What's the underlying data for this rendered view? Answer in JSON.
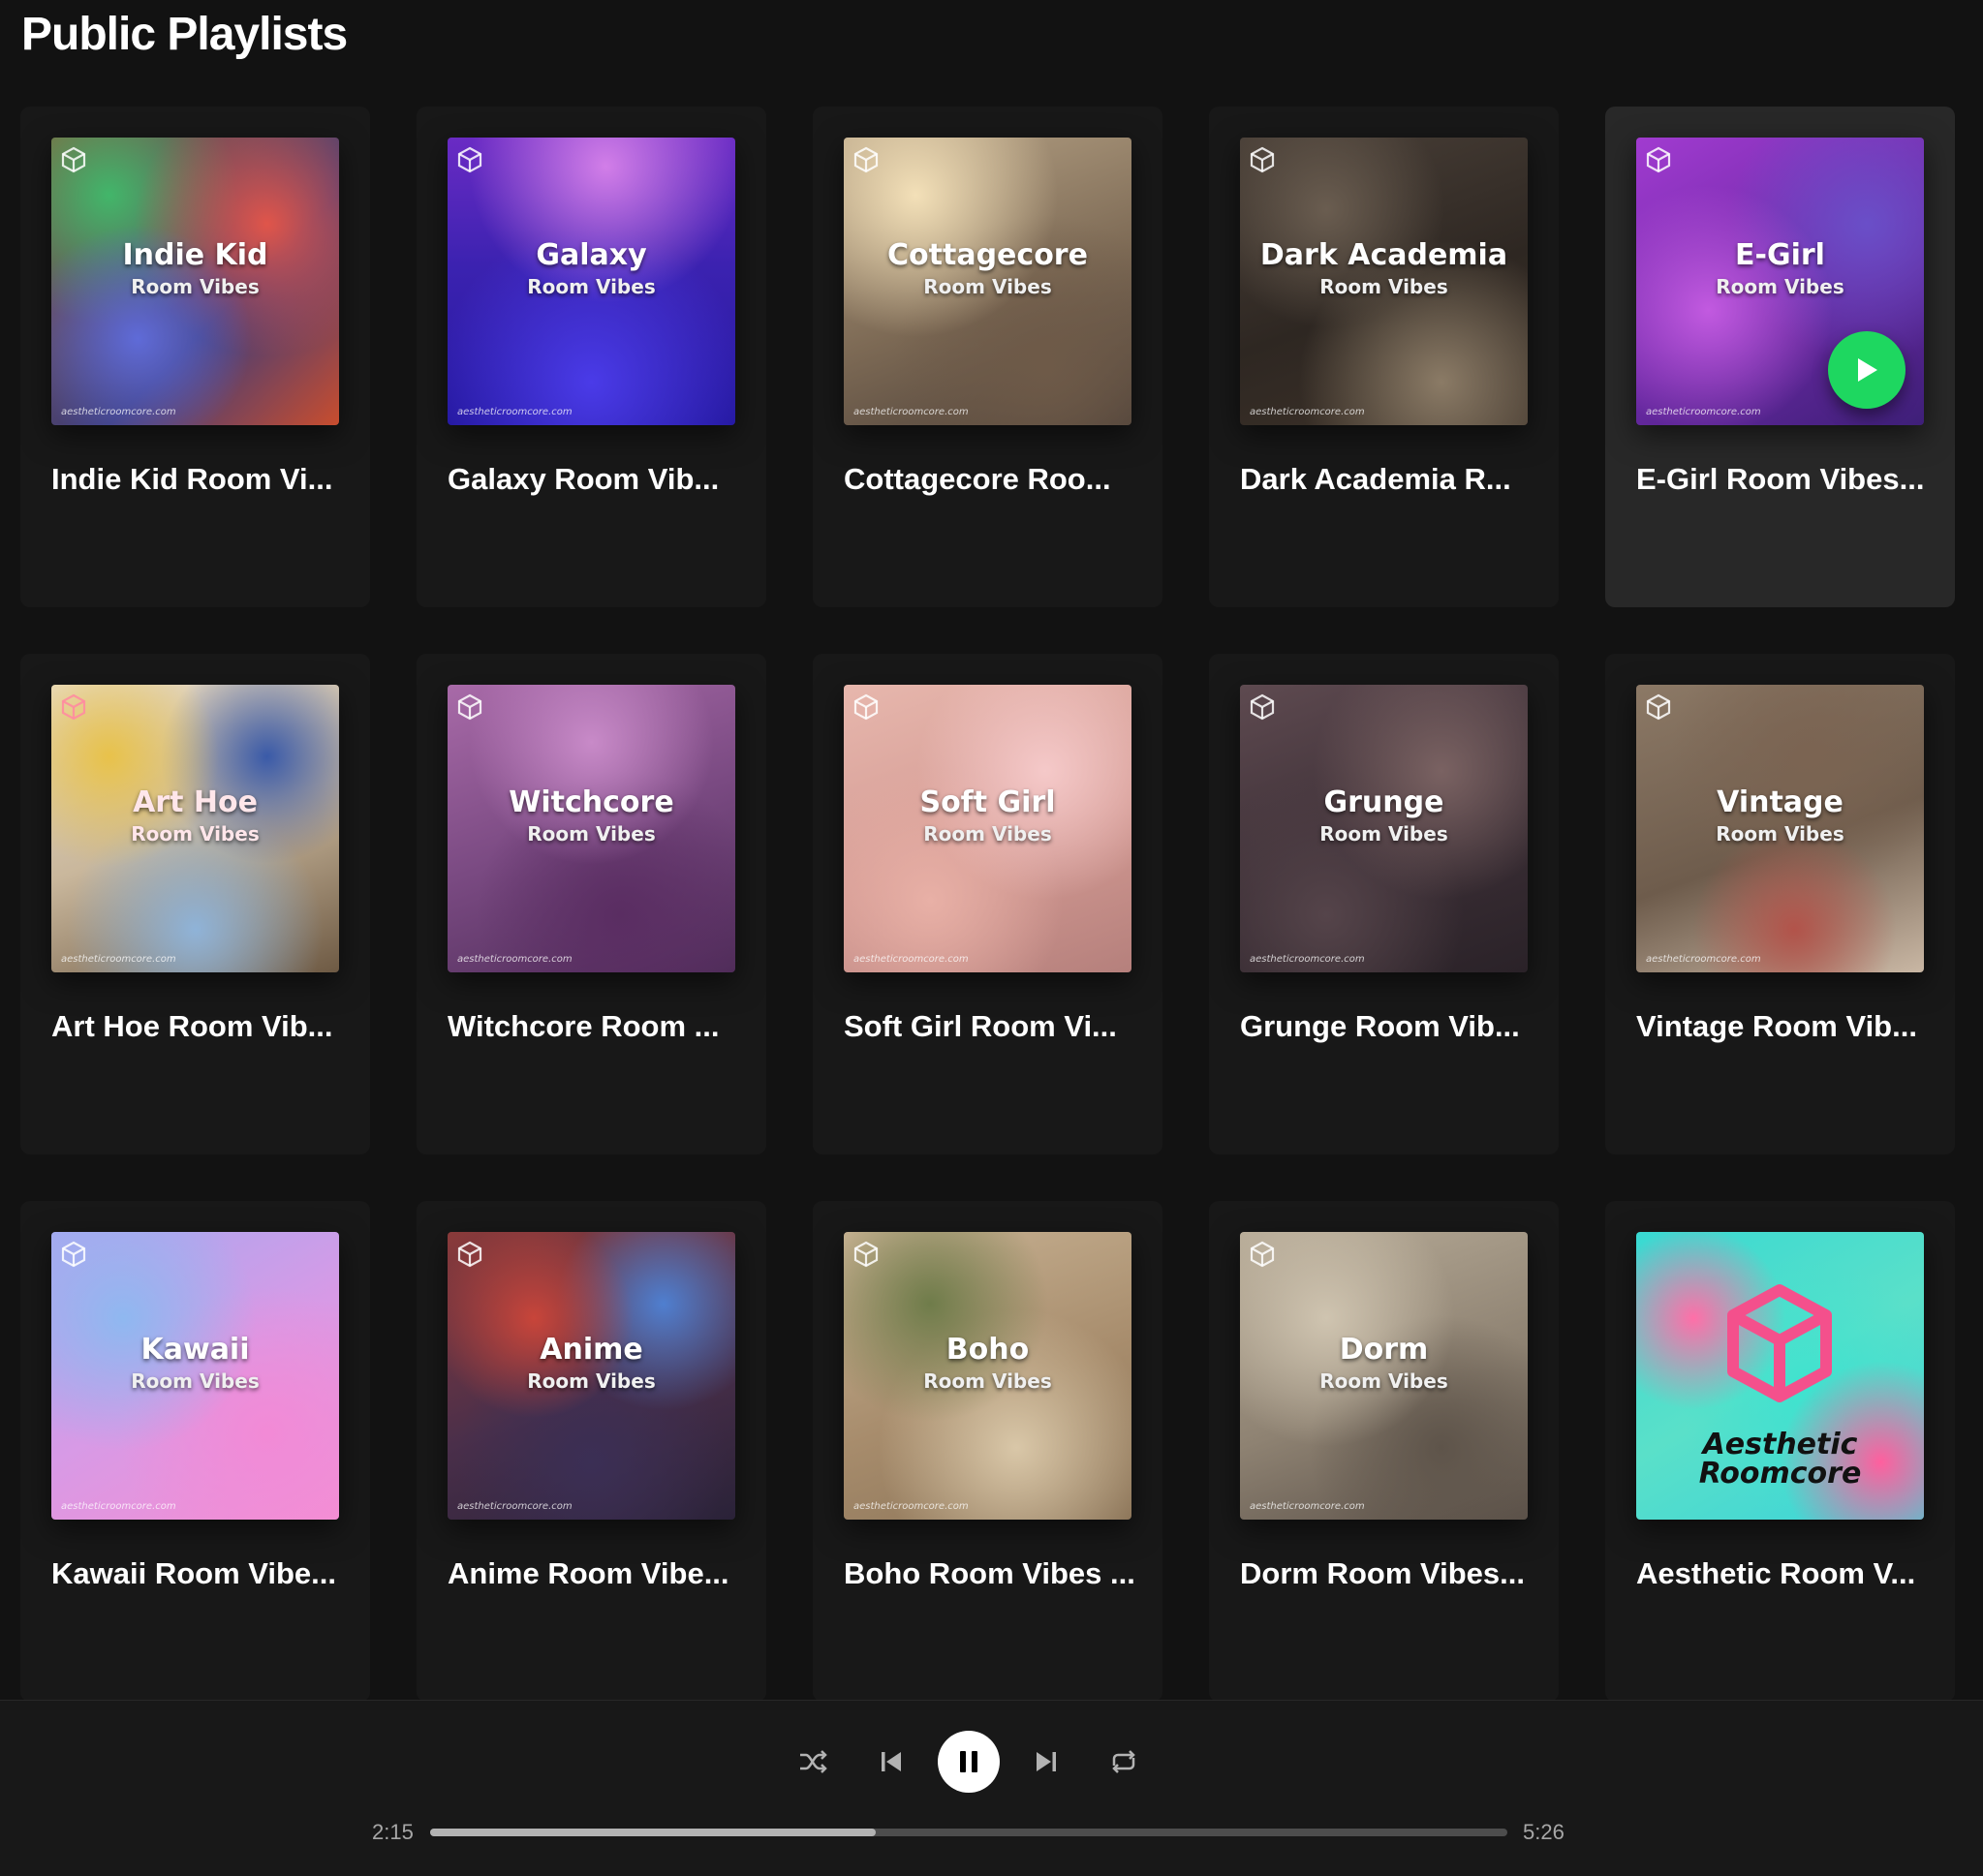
{
  "section": {
    "title": "Public Playlists"
  },
  "playlists": [
    {
      "name": "Indie Kid Room Vi...",
      "cover_title": "Indie Kid",
      "cover_subtitle": "Room Vibes",
      "watermark": "aestheticroomcore.com"
    },
    {
      "name": "Galaxy Room Vib...",
      "cover_title": "Galaxy",
      "cover_subtitle": "Room Vibes",
      "watermark": "aestheticroomcore.com"
    },
    {
      "name": "Cottagecore Roo...",
      "cover_title": "Cottagecore",
      "cover_subtitle": "Room Vibes",
      "watermark": "aestheticroomcore.com"
    },
    {
      "name": "Dark Academia R...",
      "cover_title": "Dark Academia",
      "cover_subtitle": "Room Vibes",
      "watermark": "aestheticroomcore.com"
    },
    {
      "name": "E-Girl Room Vibes...",
      "cover_title": "E-Girl",
      "cover_subtitle": "Room Vibes",
      "watermark": "aestheticroomcore.com"
    },
    {
      "name": "Art Hoe Room Vib...",
      "cover_title": "Art Hoe",
      "cover_subtitle": "Room Vibes",
      "watermark": "aestheticroomcore.com"
    },
    {
      "name": "Witchcore Room ...",
      "cover_title": "Witchcore",
      "cover_subtitle": "Room Vibes",
      "watermark": "aestheticroomcore.com"
    },
    {
      "name": "Soft Girl Room Vi...",
      "cover_title": "Soft Girl",
      "cover_subtitle": "Room Vibes",
      "watermark": "aestheticroomcore.com"
    },
    {
      "name": "Grunge Room Vib...",
      "cover_title": "Grunge",
      "cover_subtitle": "Room Vibes",
      "watermark": "aestheticroomcore.com"
    },
    {
      "name": "Vintage Room Vib...",
      "cover_title": "Vintage",
      "cover_subtitle": "Room Vibes",
      "watermark": "aestheticroomcore.com"
    },
    {
      "name": "Kawaii Room Vibe...",
      "cover_title": "Kawaii",
      "cover_subtitle": "Room Vibes",
      "watermark": "aestheticroomcore.com"
    },
    {
      "name": "Anime Room Vibe...",
      "cover_title": "Anime",
      "cover_subtitle": "Room Vibes",
      "watermark": "aestheticroomcore.com"
    },
    {
      "name": "Boho Room Vibes ...",
      "cover_title": "Boho",
      "cover_subtitle": "Room Vibes",
      "watermark": "aestheticroomcore.com"
    },
    {
      "name": "Dorm Room Vibes...",
      "cover_title": "Dorm",
      "cover_subtitle": "Room Vibes",
      "watermark": "aestheticroomcore.com"
    },
    {
      "name": "Aesthetic Room V...",
      "cover_line1": "Aesthetic",
      "cover_line2": "Roomcore"
    }
  ],
  "colors": {
    "background": "#121212",
    "card": "#181818",
    "card_hover": "#282828",
    "accent_green": "#1ed760",
    "aesthetic_cyan": "#40e0d0",
    "aesthetic_pink": "#ff5fa2"
  },
  "icons": {
    "cover_logo": "cube-logo-icon",
    "play": "play-icon",
    "shuffle": "shuffle-icon",
    "previous": "skip-back-icon",
    "pause": "pause-icon",
    "next": "skip-forward-icon",
    "repeat": "repeat-icon"
  },
  "player": {
    "elapsed": "2:15",
    "duration": "5:26",
    "progress_fraction": 0.414,
    "state": "playing"
  }
}
